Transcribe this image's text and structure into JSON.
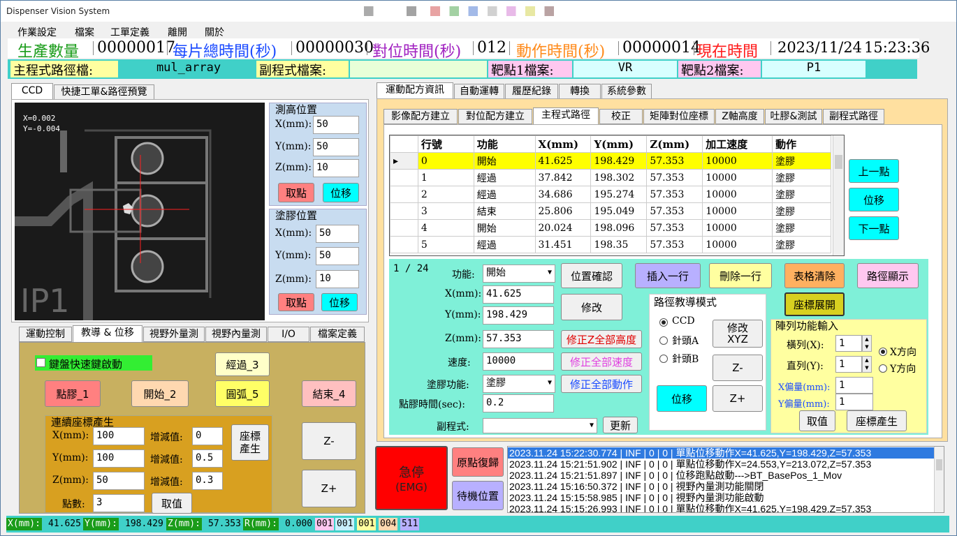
{
  "app": {
    "title": "Dispenser Vision System"
  },
  "menu": [
    "作業設定",
    "檔案",
    "工單定義",
    "離開",
    "關於"
  ],
  "status": {
    "prod_label": "生產數量",
    "prod_value": "00000017",
    "total_label": "每片總時間(秒)",
    "total_value": "00000030",
    "align_label": "對位時間(秒)",
    "align_value": "012",
    "action_label": "動作時間(秒)",
    "action_value": "00000014",
    "now_label": "現在時間",
    "date": "2023/11/24",
    "time": "15:23:36"
  },
  "files": {
    "main_label": "主程式路徑檔:",
    "main_value": "mul_array",
    "sub_label": "副程式檔案:",
    "sub_value": "",
    "t1_label": "靶點1檔案:",
    "t1_value": "VR",
    "t2_label": "靶點2檔案:",
    "t2_value": "P1"
  },
  "left_tabs": [
    "CCD",
    "快捷工單&路徑預覽"
  ],
  "ccd": {
    "x": "X=0.002",
    "y": "Y=-0.004"
  },
  "height_pos": {
    "title": "測高位置",
    "x_label": "X(mm):",
    "x": "50",
    "y_label": "Y(mm):",
    "y": "50",
    "z_label": "Z(mm):",
    "z": "10",
    "take": "取點",
    "move": "位移"
  },
  "glue_pos": {
    "title": "塗膠位置",
    "x_label": "X(mm):",
    "x": "50",
    "y_label": "Y(mm):",
    "y": "50",
    "z_label": "Z(mm):",
    "z": "10",
    "take": "取點",
    "move": "位移"
  },
  "lower_tabs": [
    "運動控制",
    "教導 & 位移",
    "視野外量測",
    "視野內量測",
    "I/O",
    "檔案定義"
  ],
  "teach": {
    "keyboard": "鍵盤快速鍵啟動",
    "via": "經過_3",
    "dot": "點膠_1",
    "start": "開始_2",
    "arc": "圓弧_5",
    "end": "結束_4",
    "cont_title": "連續座標產生",
    "x_label": "X(mm):",
    "x": "100",
    "y_label": "Y(mm):",
    "y": "100",
    "z_label": "Z(mm):",
    "z": "50",
    "inc_label": "增減值:",
    "inc_x": "0",
    "inc_y": "0.5",
    "inc_z": "0.3",
    "count_label": "點數:",
    "count": "3",
    "gen": "座標\n產生",
    "cancel": "取值",
    "zminus": "Z-",
    "zplus": "Z+"
  },
  "right_tabs": [
    "運動配方資訊",
    "自動運轉",
    "履歷紀錄",
    "轉換",
    "系統參數"
  ],
  "sub_tabs": [
    "影像配方建立",
    "對位配方建立",
    "主程式路徑",
    "校正",
    "矩陣對位座標",
    "Z軸高度",
    "吐膠&測試",
    "副程式路徑"
  ],
  "table": {
    "headers": [
      "行號",
      "功能",
      "X(mm)",
      "Y(mm)",
      "Z(mm)",
      "加工速度",
      "動作"
    ],
    "rows": [
      [
        "0",
        "開始",
        "41.625",
        "198.429",
        "57.353",
        "10000",
        "塗膠"
      ],
      [
        "1",
        "經過",
        "37.842",
        "198.302",
        "57.353",
        "10000",
        "塗膠"
      ],
      [
        "2",
        "經過",
        "34.686",
        "195.274",
        "57.353",
        "10000",
        "塗膠"
      ],
      [
        "3",
        "結束",
        "25.806",
        "195.049",
        "57.353",
        "10000",
        "塗膠"
      ],
      [
        "4",
        "開始",
        "20.024",
        "198.096",
        "57.353",
        "10000",
        "塗膠"
      ],
      [
        "5",
        "經過",
        "31.451",
        "198.35",
        "57.353",
        "10000",
        "塗膠"
      ]
    ]
  },
  "nav": {
    "prev": "上一點",
    "move": "位移",
    "next": "下一點"
  },
  "edit": {
    "counter": "1 / 24",
    "func_label": "功能:",
    "func": "開始",
    "x_label": "X(mm):",
    "x": "41.625",
    "y_label": "Y(mm):",
    "y": "198.429",
    "z_label": "Z(mm):",
    "z": "57.353",
    "speed_label": "速度:",
    "speed": "10000",
    "glue_label": "塗膠功能:",
    "glue": "塗膠",
    "time_label": "點膠時間(sec):",
    "time": "0.2",
    "sub_label": "副程式:",
    "sub": "",
    "confirm": "位置確認",
    "modify": "修改",
    "fix_z": "修正Z全部高度",
    "fix_speed": "修正全部速度",
    "fix_action": "修正全部動作",
    "refresh": "更新",
    "insert": "插入一行",
    "delete": "刪除一行",
    "clear": "表格清除",
    "show": "路徑顯示",
    "expand": "座標展開"
  },
  "teach_mode": {
    "title": "路徑教導模式",
    "opt1": "CCD",
    "opt2": "針頭A",
    "opt3": "針頭B",
    "modify_xyz": "修改\nXYZ",
    "zminus": "Z-",
    "zplus": "Z+",
    "move": "位移"
  },
  "array": {
    "title": "陣列功能輸入",
    "cols_label": "橫列(X):",
    "cols": "1",
    "rows_label": "直列(Y):",
    "rows": "1",
    "xoff_label": "X偏量(mm):",
    "xoff": "1",
    "yoff_label": "Y偏量(mm):",
    "yoff": "1",
    "xdir": "X方向",
    "ydir": "Y方向",
    "cancel": "取值",
    "gen": "座標產生"
  },
  "control": {
    "emg": "急停",
    "emg_sub": "(EMG)",
    "home": "原點復歸",
    "standby": "待機位置"
  },
  "log": [
    "2023.11.24 15:22:30.774 | INF | 0 | 0 | 單點位移動作X=41.625,Y=198.429,Z=57.353",
    "2023.11.24 15:21:51.902 | INF | 0 | 0 | 單點位移動作X=24.553,Y=213.072,Z=57.353",
    "2023.11.24 15:21:51.897 | INF | 0 | 0 | 位移跑點啟動--->BT_BasePos_1_Mov",
    "2023.11.24 15:16:50.372 | INF | 0 | 0 | 視野內量測功能關閉",
    "2023.11.24 15:15:58.985 | INF | 0 | 0 | 視野內量測功能啟動",
    "2023.11.24 15:15:26.993 | INF | 0 | 0 | 單點位移動作X=41.625,Y=198.429,Z=57.353"
  ],
  "bottom": {
    "x_label": "X(mm):",
    "x": "41.625",
    "y_label": "Y(mm):",
    "y": "198.429",
    "z_label": "Z(mm):",
    "z": "57.353",
    "r_label": "R(mm):",
    "r": "0.000",
    "c1": "001",
    "c2": "001",
    "c3": "001",
    "c4": "004",
    "c5": "511"
  },
  "colors": {
    "accent_cyan": "#00ffff",
    "panel_teal": "#7ff0d8",
    "emg_red": "#ff0000",
    "olive": "#c8b060"
  }
}
